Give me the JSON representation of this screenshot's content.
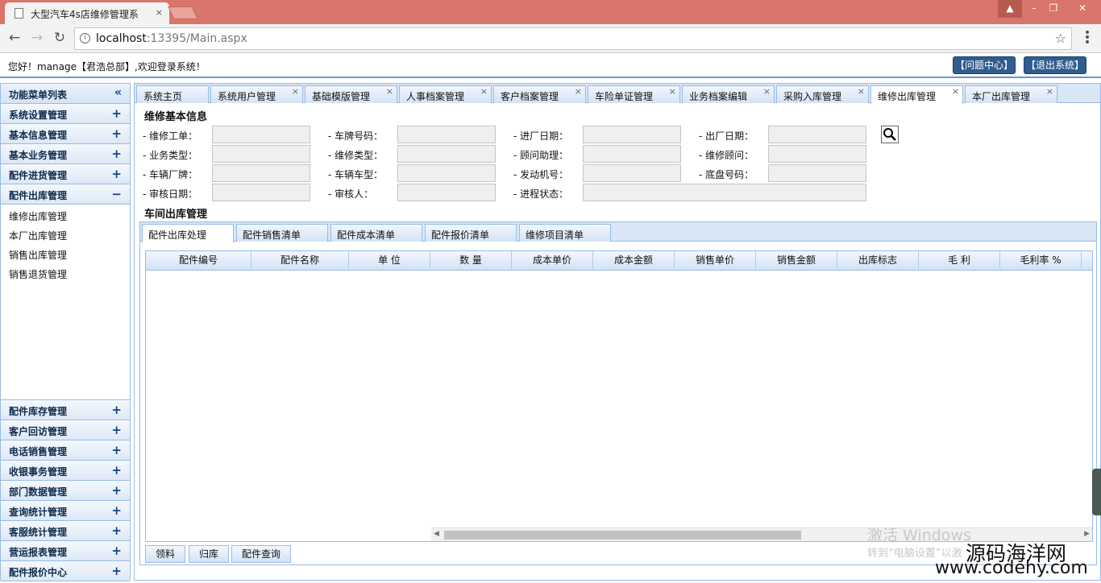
{
  "browser": {
    "tab_title": "大型汽车4s店维修管理系",
    "tab_close": "×",
    "url_host": "localhost",
    "url_rest": ":13395/Main.aspx",
    "win_user": "▲",
    "win_min": "–",
    "win_max": "❐",
    "win_close": "✕",
    "back": "←",
    "forward": "→",
    "reload": "↻",
    "star": "☆",
    "info": "i",
    "menu": "•\n•\n•"
  },
  "header": {
    "welcome": "您好！manage【君浩总部】,欢迎登录系统！",
    "help_button": "【问题中心】",
    "exit_button": "【退出系统】"
  },
  "sidebar": {
    "title": "功能菜单列表",
    "collapse": "«",
    "sections_top": [
      {
        "label": "系统设置管理",
        "sign": "+"
      },
      {
        "label": "基本信息管理",
        "sign": "+"
      },
      {
        "label": "基本业务管理",
        "sign": "+"
      },
      {
        "label": "配件进货管理",
        "sign": "+"
      },
      {
        "label": "配件出库管理",
        "sign": "−"
      }
    ],
    "items": [
      "维修出库管理",
      "本厂出库管理",
      "销售出库管理",
      "销售退货管理"
    ],
    "sections_bottom": [
      {
        "label": "配件库存管理",
        "sign": "+"
      },
      {
        "label": "客户回访管理",
        "sign": "+"
      },
      {
        "label": "电话销售管理",
        "sign": "+"
      },
      {
        "label": "收银事务管理",
        "sign": "+"
      },
      {
        "label": "部门数据管理",
        "sign": "+"
      },
      {
        "label": "查询统计管理",
        "sign": "+"
      },
      {
        "label": "客服统计管理",
        "sign": "+"
      },
      {
        "label": "营运报表管理",
        "sign": "+"
      },
      {
        "label": "配件报价中心",
        "sign": "+"
      }
    ]
  },
  "main_tabs": [
    {
      "label": "系统主页",
      "close": ""
    },
    {
      "label": "系统用户管理",
      "close": "×"
    },
    {
      "label": "基础模版管理",
      "close": "×"
    },
    {
      "label": "人事档案管理",
      "close": "×"
    },
    {
      "label": "客户档案管理",
      "close": "×"
    },
    {
      "label": "车险单证管理",
      "close": "×"
    },
    {
      "label": "业务档案编辑",
      "close": "×"
    },
    {
      "label": "采购入库管理",
      "close": "×"
    },
    {
      "label": "维修出库管理",
      "close": "×"
    },
    {
      "label": "本厂出库管理",
      "close": "×"
    }
  ],
  "basic_info": {
    "title": "维修基本信息",
    "fields": [
      {
        "label": "- 维修工单：",
        "value": ""
      },
      {
        "label": "- 车牌号码：",
        "value": ""
      },
      {
        "label": "- 进厂日期：",
        "value": ""
      },
      {
        "label": "- 出厂日期：",
        "value": ""
      },
      {
        "label": "- 业务类型：",
        "value": ""
      },
      {
        "label": "- 维修类型：",
        "value": ""
      },
      {
        "label": "- 顾问助理：",
        "value": ""
      },
      {
        "label": "- 维修顾问：",
        "value": ""
      },
      {
        "label": "- 车辆厂牌：",
        "value": ""
      },
      {
        "label": "- 车辆车型：",
        "value": ""
      },
      {
        "label": "- 发动机号：",
        "value": ""
      },
      {
        "label": "- 底盘号码：",
        "value": ""
      },
      {
        "label": "- 审核日期：",
        "value": ""
      },
      {
        "label": "- 审核人：",
        "value": ""
      },
      {
        "label": "- 进程状态：",
        "value": ""
      }
    ]
  },
  "workshop": {
    "title": "车间出库管理",
    "tabs": [
      "配件出库处理",
      "配件销售清单",
      "配件成本清单",
      "配件报价清单",
      "维修项目清单"
    ],
    "columns": [
      "配件编号",
      "配件名称",
      "单 位",
      "数 量",
      "成本单价",
      "成本金额",
      "销售单价",
      "销售金额",
      "出库标志",
      "毛 利",
      "毛利率 %"
    ],
    "scroll_left": "◀",
    "scroll_right": "▶",
    "buttons": [
      "领料",
      "归库",
      "配件查询"
    ]
  },
  "overlay": {
    "activate_title": "激活 Windows",
    "activate_sub": "转到“电脑设置”以激",
    "brand_cn": "源码海洋网",
    "brand_url": "www.codehy.com"
  }
}
